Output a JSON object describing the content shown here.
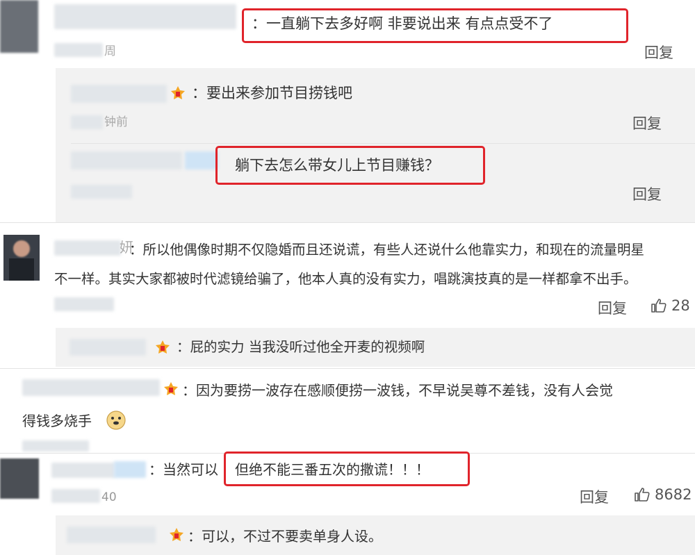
{
  "comments": [
    {
      "text": "：一直躺下去多好啊 非要说出来 有点点受不了",
      "meta": "周",
      "reply_label": "回复",
      "sub_replies": [
        {
          "text": "：要出来参加节目捞钱吧",
          "meta": "钟前",
          "reply_label": "回复"
        },
        {
          "text": "躺下去怎么带女儿上节目赚钱？",
          "reply_label": "回复"
        }
      ]
    },
    {
      "name_tail": "妍",
      "text_line1": "：所以他偶像时期不仅隐婚而且还说谎，有些人还说什么他靠实力，和现在的流量明星",
      "text_line2": "不一样。其实大家都被时代滤镜给骗了，他本人真的没有实力，唱跳演技真的是一样都拿不出手。",
      "reply_label": "回复",
      "like_count": "28",
      "sub_replies": [
        {
          "text": "：屁的实力 当我没听过他全开麦的视频啊"
        }
      ]
    },
    {
      "text_line1": "：因为要捞一波存在感顺便捞一波钱，不早说吴尊不差钱，没有人会觉",
      "text_line2": "得钱多烧手",
      "emoji": "doge-emoji"
    },
    {
      "text_plain": "：当然可以",
      "text_highlight": "但绝不能三番五次的撒谎！！！",
      "meta": "40",
      "reply_label": "回复",
      "like_count": "8682",
      "sub_replies": [
        {
          "text": "：可以，不过不要卖单身人设。"
        }
      ]
    }
  ],
  "colors": {
    "highlight_border": "#e0242b",
    "reply_background": "#f2f2f2",
    "vip_badge": "#f5a623"
  }
}
